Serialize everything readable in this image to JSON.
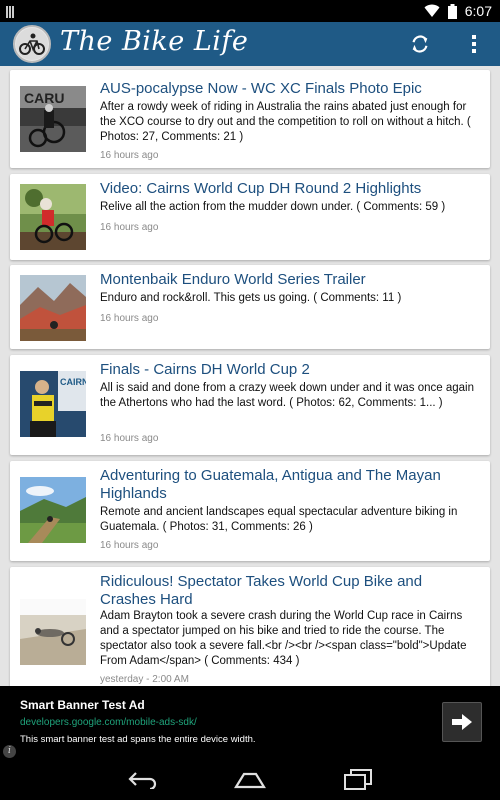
{
  "status_bar": {
    "time": "6:07"
  },
  "app_bar": {
    "title": "The Bike Life",
    "refresh_icon": "refresh-icon",
    "overflow_icon": "more-vert-icon",
    "color": "#1f5a86"
  },
  "articles": [
    {
      "title": "AUS-pocalypse Now - WC XC Finals Photo Epic",
      "description": "After a rowdy week of riding in Australia the rains abated just enough for the XCO course to dry out and the competition to roll on without a hitch. ( Photos: 27, Comments: 21 )",
      "time": "16 hours ago"
    },
    {
      "title": "Video: Cairns World Cup DH Round 2 Highlights",
      "description": "Relive all the action from the mudder down under. ( Comments: 59 )",
      "time": "16 hours ago"
    },
    {
      "title": "Montenbaik Enduro World Series Trailer",
      "description": "Enduro and rock&roll. This gets us going. ( Comments: 11 )",
      "time": "16 hours ago"
    },
    {
      "title": "Finals - Cairns DH World Cup 2",
      "description": "All is said and done from a crazy week down under and it was once again the Athertons who had the last word. ( Photos: 62, Comments: 1... )",
      "time": "16 hours ago"
    },
    {
      "title": "Adventuring to Guatemala, Antigua and The Mayan Highlands",
      "description": "Remote and ancient landscapes equal spectacular adventure biking in Guatemala. ( Photos: 31, Comments: 26 )",
      "time": "16 hours ago"
    },
    {
      "title": "Ridiculous! Spectator Takes World Cup Bike and Crashes Hard",
      "description": "Adam Brayton took a severe crash during the World Cup race in Cairns and a spectator jumped on his bike and tried to ride the course. The spectator also took a severe fall.<br /><br /><span class=\"bold\">Update From Adam</span> ( Comments: 434 )",
      "time": "yesterday - 2:00 AM"
    }
  ],
  "ad": {
    "title": "Smart Banner Test Ad",
    "url": "developers.google.com/mobile-ads-sdk/",
    "description": "This smart banner test ad spans the entire device width.",
    "button_icon": "arrow-right-icon",
    "info_icon": "info-icon"
  },
  "nav_bar": {
    "back_icon": "back-icon",
    "home_icon": "home-icon",
    "recents_icon": "recents-icon"
  }
}
